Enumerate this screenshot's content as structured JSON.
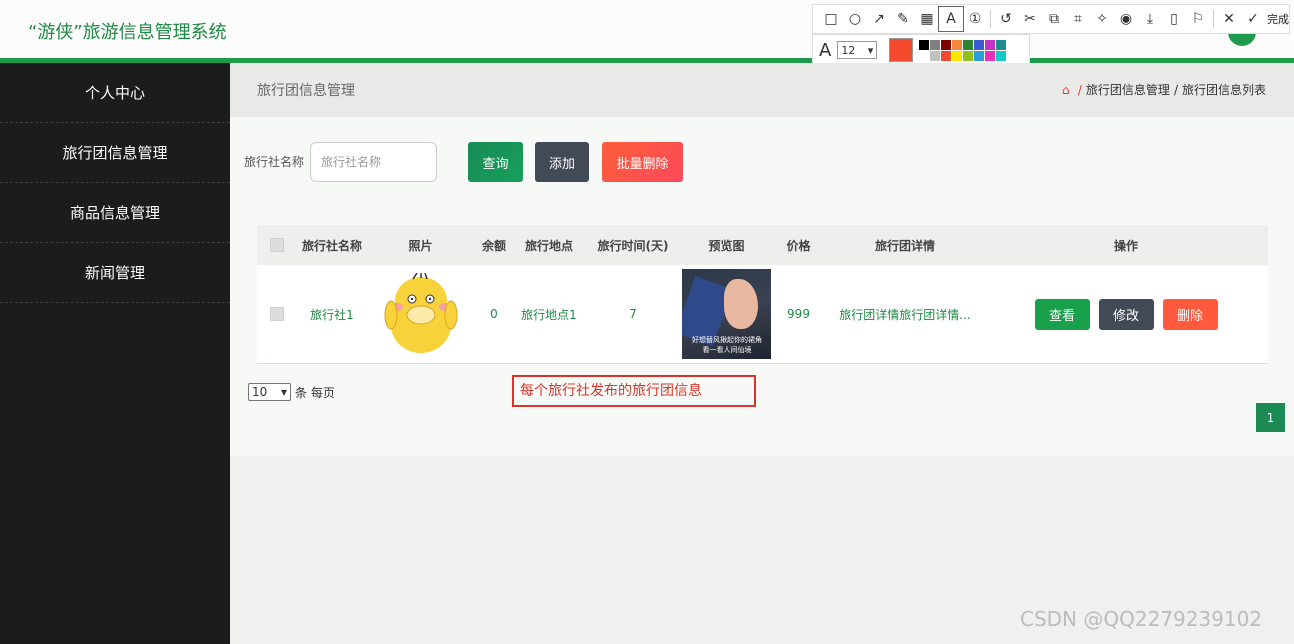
{
  "header": {
    "title": "“游侠”旅游信息管理系统"
  },
  "screenshot_toolbar": {
    "tools": [
      "rectangle-icon",
      "ellipse-icon",
      "arrow-icon",
      "pen-icon",
      "mosaic-icon",
      "text-icon",
      "number-icon",
      "undo-icon",
      "cutout-icon",
      "translate-icon",
      "ocr-icon",
      "pin-icon",
      "record-icon",
      "download-icon",
      "phone-icon",
      "bookmark-icon",
      "close-icon",
      "check-icon"
    ],
    "done_label": "完成",
    "font_size": "12",
    "current_color": "#f34a2e",
    "palette": [
      "#000000",
      "#808080",
      "#800000",
      "#f7883a",
      "#308430",
      "#385ad3",
      "#c531c7",
      "#1c8e8e",
      "#ffffff",
      "#c0c0c0",
      "#f34a2e",
      "#fbe600",
      "#93c11a",
      "#29a0dc",
      "#f02cc1",
      "#17c6c6"
    ]
  },
  "sidebar": {
    "items": [
      {
        "label": "个人中心"
      },
      {
        "label": "旅行团信息管理"
      },
      {
        "label": "商品信息管理"
      },
      {
        "label": "新闻管理"
      }
    ]
  },
  "breadcrumb": {
    "page_title": "旅行团信息管理",
    "items": [
      "旅行团信息管理",
      "旅行团信息列表"
    ],
    "separator": "/"
  },
  "search": {
    "label": "旅行社名称",
    "placeholder": "旅行社名称",
    "query_label": "查询",
    "add_label": "添加",
    "batch_delete_label": "批量删除"
  },
  "table": {
    "headers": [
      "旅行社名称",
      "照片",
      "余额",
      "旅行地点",
      "旅行时间(天)",
      "预览图",
      "价格",
      "旅行团详情",
      "操作"
    ],
    "rows": [
      {
        "name": "旅行社1",
        "balance": "0",
        "location": "旅行地点1",
        "days": "7",
        "preview_caption_1": "好想替风揪起你的裙角",
        "preview_caption_2": "看一看人间仙境",
        "price": "999",
        "detail": "旅行团详情旅行团详情...",
        "view_label": "查看",
        "edit_label": "修改",
        "delete_label": "删除"
      }
    ]
  },
  "pagination": {
    "page_size": "10",
    "page_size_suffix": "条 每页",
    "current_page": "1"
  },
  "annotation_text": "每个旅行社发布的旅行团信息",
  "watermark": "CSDN @QQ2279239102"
}
